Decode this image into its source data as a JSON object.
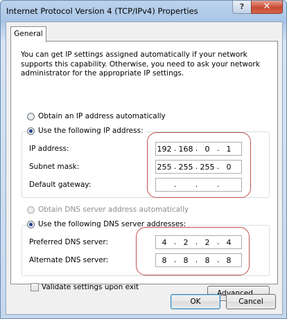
{
  "window": {
    "title": "Internet Protocol Version 4 (TCP/IPv4) Properties",
    "help_label": "?",
    "close_label": "✕"
  },
  "tabs": [
    {
      "label": "General"
    }
  ],
  "intro_text": "You can get IP settings assigned automatically if your network supports this capability. Otherwise, you need to ask your network administrator for the appropriate IP settings.",
  "ip_section": {
    "auto_label": "Obtain an IP address automatically",
    "manual_label": "Use the following IP address:",
    "selected": "manual",
    "fields": [
      {
        "label": "IP address:",
        "octets": [
          "192",
          "168",
          "0",
          "1"
        ]
      },
      {
        "label": "Subnet mask:",
        "octets": [
          "255",
          "255",
          "255",
          "0"
        ]
      },
      {
        "label": "Default gateway:",
        "octets": [
          "",
          "",
          "",
          ""
        ]
      }
    ]
  },
  "dns_section": {
    "auto_label": "Obtain DNS server address automatically",
    "auto_disabled": true,
    "manual_label": "Use the following DNS server addresses:",
    "selected": "manual",
    "fields": [
      {
        "label": "Preferred DNS server:",
        "octets": [
          "4",
          "2",
          "2",
          "4"
        ]
      },
      {
        "label": "Alternate DNS server:",
        "octets": [
          "8",
          "8",
          "8",
          "8"
        ]
      }
    ]
  },
  "validate": {
    "label": "Validate settings upon exit",
    "checked": false
  },
  "buttons": {
    "advanced": "Advanced...",
    "ok": "OK",
    "cancel": "Cancel"
  },
  "colors": {
    "highlight": "#c0504d",
    "accent": "#1e3f8e"
  }
}
